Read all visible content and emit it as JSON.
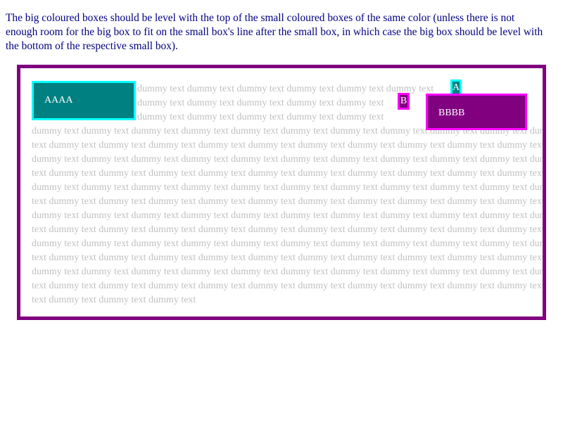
{
  "description": "The big coloured boxes should be level with the top of the small coloured boxes of the same color (unless there is not enough room for the big box to fit on the small box's line after the small box, in which case the big box should be level with the bottom of the respective small box).",
  "big_box_a": {
    "label": "AAAA"
  },
  "big_box_b": {
    "label": "BBBB"
  },
  "small_box_a": {
    "label": "A"
  },
  "small_box_b": {
    "label": "B"
  },
  "dummy_lines": [
    "dummy text dummy text dummy text dummy text dummy text dummy text",
    "dummy text dummy text dummy text dummy text dummy text",
    "dummy text dummy text dummy text dummy text dummy text",
    "dummy text dummy text dummy text dummy text dummy text dummy text dummy text dummy text dummy text dummy text dummy",
    "text dummy text dummy text dummy text dummy text dummy text dummy text dummy text dummy text dummy text dummy text",
    "dummy text dummy text dummy text dummy text dummy text dummy text dummy text dummy text dummy text dummy text dummy",
    "text dummy text dummy text dummy text dummy text dummy text dummy text dummy text dummy text dummy text dummy text",
    "dummy text dummy text dummy text dummy text dummy text dummy text dummy text dummy text dummy text dummy text dummy",
    "text dummy text dummy text dummy text dummy text dummy text dummy text dummy text dummy text dummy text dummy text",
    "dummy text dummy text dummy text dummy text dummy text dummy text dummy text dummy text dummy text dummy text dummy",
    "text dummy text dummy text dummy text dummy text dummy text dummy text dummy text dummy text dummy text dummy text",
    "dummy text dummy text dummy text dummy text dummy text dummy text dummy text dummy text dummy text dummy text dummy",
    "text dummy text dummy text dummy text dummy text dummy text dummy text dummy text dummy text dummy text dummy text",
    "dummy text dummy text dummy text dummy text dummy text dummy text dummy text dummy text dummy text dummy text dummy",
    "text dummy text dummy text dummy text dummy text dummy text dummy text dummy text dummy text dummy text dummy text",
    "text dummy text dummy text dummy text"
  ],
  "colors": {
    "description_text": "#000080",
    "container_border": "#800080",
    "dummy_text": "#c0c0c0",
    "teal_fill": "#008080",
    "teal_border": "#00ffff",
    "purple_fill": "#800080",
    "magenta_border": "#ff00ff",
    "box_text": "#ffffff"
  }
}
